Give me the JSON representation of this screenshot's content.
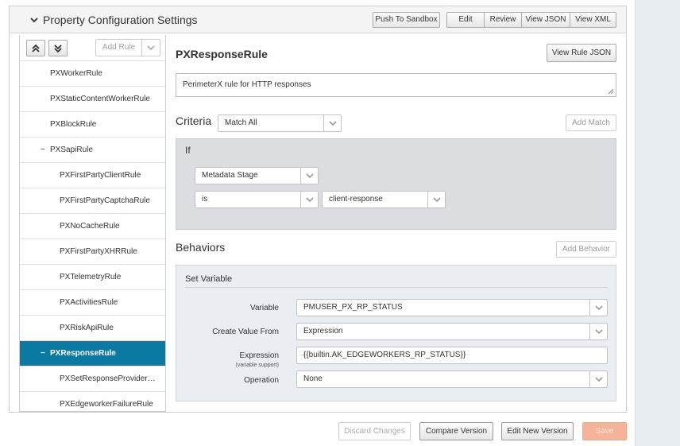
{
  "panel": {
    "title": "Property Configuration Settings",
    "actions": {
      "push_to_sandbox": "Push To Sandbox",
      "edit": "Edit",
      "review": "Review",
      "view_json": "View JSON",
      "view_xml": "View XML"
    }
  },
  "sidebar": {
    "add_rule_label": "Add Rule",
    "items": [
      {
        "label": "PXWorkerRule",
        "level": 1,
        "toggle": "",
        "selected": false
      },
      {
        "label": "PXStaticContentWorkerRule",
        "level": 1,
        "toggle": "",
        "selected": false
      },
      {
        "label": "PXBlockRule",
        "level": 1,
        "toggle": "",
        "selected": false
      },
      {
        "label": "PXSapiRule",
        "level": 1,
        "toggle": "−",
        "selected": false
      },
      {
        "label": "PXFirstPartyClientRule",
        "level": 2,
        "toggle": "",
        "selected": false
      },
      {
        "label": "PXFirstPartyCaptchaRule",
        "level": 2,
        "toggle": "",
        "selected": false
      },
      {
        "label": "PXNoCacheRule",
        "level": 2,
        "toggle": "",
        "selected": false
      },
      {
        "label": "PXFirstPartyXHRRule",
        "level": 2,
        "toggle": "",
        "selected": false
      },
      {
        "label": "PXTelemetryRule",
        "level": 2,
        "toggle": "",
        "selected": false
      },
      {
        "label": "PXActivitiesRule",
        "level": 2,
        "toggle": "",
        "selected": false
      },
      {
        "label": "PXRiskApiRule",
        "level": 2,
        "toggle": "",
        "selected": false
      },
      {
        "label": "PXResponseRule",
        "level": 1,
        "toggle": "−",
        "selected": true
      },
      {
        "label": "PXSetResponseProvider…",
        "level": 2,
        "toggle": "",
        "selected": false
      },
      {
        "label": "PXEdgeworkerFailureRule",
        "level": 2,
        "toggle": "",
        "selected": false
      }
    ]
  },
  "rule": {
    "name": "PXResponseRule",
    "view_rule_json": "View Rule JSON",
    "comment": "PerimeterX rule for HTTP responses"
  },
  "criteria": {
    "title": "Criteria",
    "match_mode": "Match All",
    "add_match": "Add Match",
    "if_label": "If",
    "condition": {
      "field": "Metadata Stage",
      "operator": "is",
      "value": "client-response"
    }
  },
  "behaviors": {
    "title": "Behaviors",
    "add_behavior": "Add Behavior",
    "set_variable": {
      "heading": "Set Variable",
      "variable_label": "Variable",
      "variable_value": "PMUSER_PX_RP_STATUS",
      "create_from_label": "Create Value From",
      "create_from_value": "Expression",
      "expression_label": "Expression",
      "expression_sub": "(variable support)",
      "expression_value": "{{builtin.AK_EDGEWORKERS_RP_STATUS}}",
      "operation_label": "Operation",
      "operation_value": "None"
    }
  },
  "footer": {
    "discard": "Discard Changes",
    "compare": "Compare Version",
    "edit_new": "Edit New Version",
    "save": "Save"
  },
  "colors": {
    "selected_row": "#0a7aa3",
    "save_button": "#f7b399"
  }
}
